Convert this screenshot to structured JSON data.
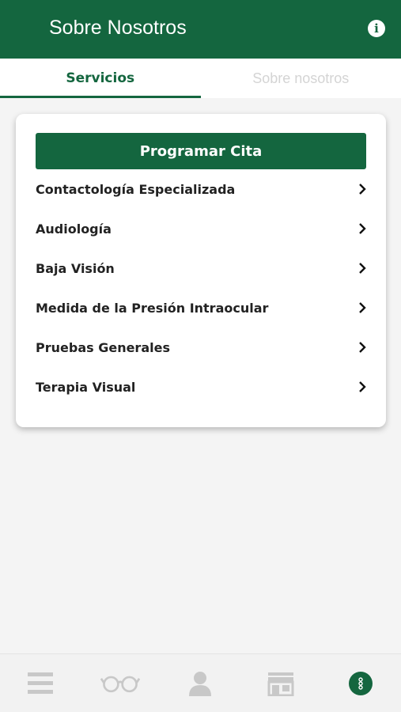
{
  "header": {
    "title": "Sobre Nosotros",
    "info_icon": "info-icon"
  },
  "tabs": [
    {
      "label": "Servicios",
      "active": true
    },
    {
      "label": "Sobre nosotros",
      "active": false
    }
  ],
  "card": {
    "cta_label": "Programar Cita",
    "services": [
      {
        "label": "Contactología Especializada",
        "icon": "chevron-right-icon"
      },
      {
        "label": "Audiología",
        "icon": "chevron-right-icon"
      },
      {
        "label": "Baja Visión",
        "icon": "chevron-right-icon"
      },
      {
        "label": "Medida de la Presión Intraocular",
        "icon": "chevron-right-icon"
      },
      {
        "label": "Pruebas Generales",
        "icon": "chevron-right-icon"
      },
      {
        "label": "Terapia Visual",
        "icon": "chevron-right-icon"
      }
    ]
  },
  "bottom_nav": [
    {
      "icon": "menu-icon",
      "active": false
    },
    {
      "icon": "glasses-icon",
      "active": false
    },
    {
      "icon": "user-icon",
      "active": false
    },
    {
      "icon": "store-icon",
      "active": false
    },
    {
      "icon": "more-dots-icon",
      "active": true
    }
  ],
  "colors": {
    "primary": "#14663f",
    "background": "#f4f4f4",
    "inactive_tab": "#d4d4d4",
    "inactive_icon": "#c8c8c8"
  }
}
